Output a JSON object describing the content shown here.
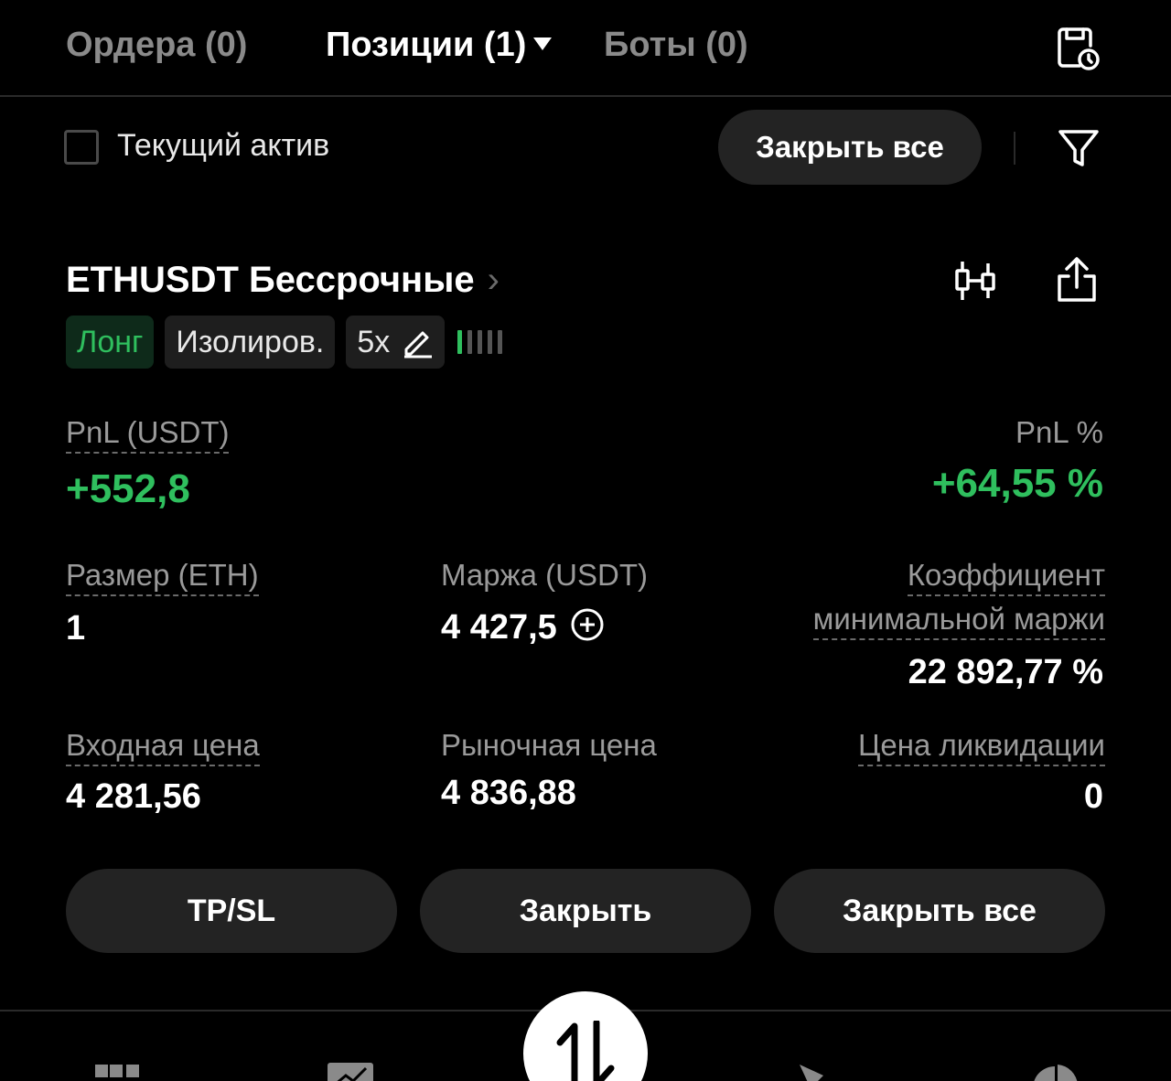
{
  "tabs": {
    "orders": "Ордера (0)",
    "positions": "Позиции (1)",
    "bots": "Боты (0)"
  },
  "filter": {
    "current_asset_label": "Текущий актив",
    "current_asset_checked": false,
    "close_all": "Закрыть все"
  },
  "position": {
    "symbol": "ETHUSDT Бессрочные",
    "side": "Лонг",
    "margin_mode": "Изолиров.",
    "leverage": "5x",
    "risk_level": 0.2,
    "pnl_label": "PnL (USDT)",
    "pnl_value": "+552,8",
    "pnl_pct_label": "PnL %",
    "pnl_pct_value": "+64,55 %",
    "size_label": "Размер (ETH)",
    "size_value": "1",
    "margin_label": "Маржа (USDT)",
    "margin_value": "4 427,5",
    "mmr_label_line1": "Коэффициент",
    "mmr_label_line2": "минимальной маржи",
    "mmr_value": "22 892,77 %",
    "entry_label": "Входная цена",
    "entry_value": "4 281,56",
    "market_label": "Рыночная цена",
    "market_value": "4 836,88",
    "liq_label": "Цена ликвидации",
    "liq_value": "0"
  },
  "actions": {
    "tpsl": "TP/SL",
    "close": "Закрыть",
    "close_all": "Закрыть все"
  },
  "colors": {
    "positive": "#2fbf5e",
    "background": "#000000",
    "pill": "#232323"
  }
}
